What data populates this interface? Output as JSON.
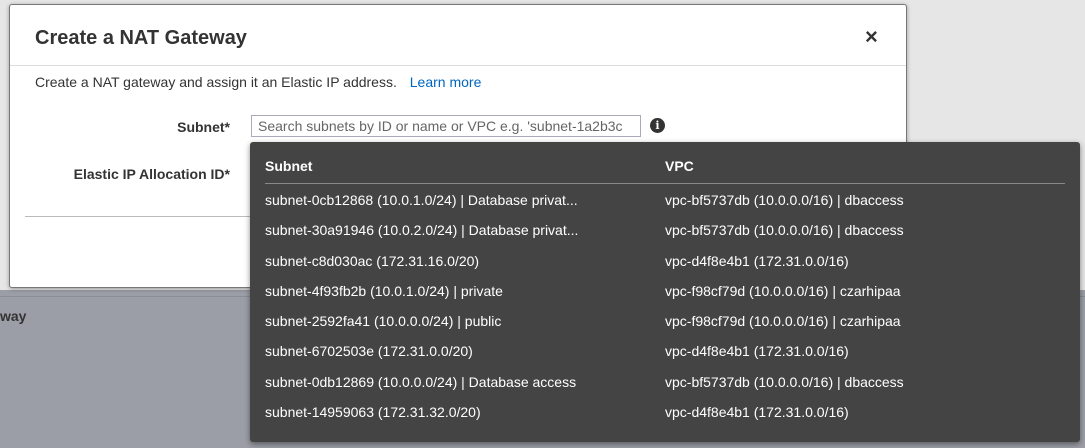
{
  "background": {
    "partial_text": "way"
  },
  "modal": {
    "title": "Create a NAT Gateway",
    "close_symbol": "×",
    "description": "Create a NAT gateway and assign it an Elastic IP address.",
    "learn_more": "Learn more",
    "subnet_label": "Subnet*",
    "subnet_placeholder": "Search subnets by ID or name or VPC e.g. 'subnet-1a2b3c",
    "subnet_value": "",
    "eip_label": "Elastic IP Allocation ID*",
    "info_icon": "i"
  },
  "dropdown": {
    "col_subnet": "Subnet",
    "col_vpc": "VPC",
    "rows": [
      {
        "subnet": "subnet-0cb12868 (10.0.1.0/24) | Database privat...",
        "vpc": "vpc-bf5737db (10.0.0.0/16) | dbaccess"
      },
      {
        "subnet": "subnet-30a91946 (10.0.2.0/24) | Database privat...",
        "vpc": "vpc-bf5737db (10.0.0.0/16) | dbaccess"
      },
      {
        "subnet": "subnet-c8d030ac (172.31.16.0/20)",
        "vpc": "vpc-d4f8e4b1 (172.31.0.0/16)"
      },
      {
        "subnet": "subnet-4f93fb2b (10.0.1.0/24) | private",
        "vpc": "vpc-f98cf79d (10.0.0.0/16) | czarhipaa"
      },
      {
        "subnet": "subnet-2592fa41 (10.0.0.0/24) | public",
        "vpc": "vpc-f98cf79d (10.0.0.0/16) | czarhipaa"
      },
      {
        "subnet": "subnet-6702503e (172.31.0.0/20)",
        "vpc": "vpc-d4f8e4b1 (172.31.0.0/16)"
      },
      {
        "subnet": "subnet-0db12869 (10.0.0.0/24) | Database access",
        "vpc": "vpc-bf5737db (10.0.0.0/16) | dbaccess"
      },
      {
        "subnet": "subnet-14959063 (172.31.32.0/20)",
        "vpc": "vpc-d4f8e4b1 (172.31.0.0/16)"
      }
    ]
  },
  "colors": {
    "link": "#0066c0",
    "dropdown_bg": "#444444",
    "backdrop": "#9b9ea6"
  },
  "icons": {
    "close": "close-icon",
    "info": "info-icon"
  }
}
